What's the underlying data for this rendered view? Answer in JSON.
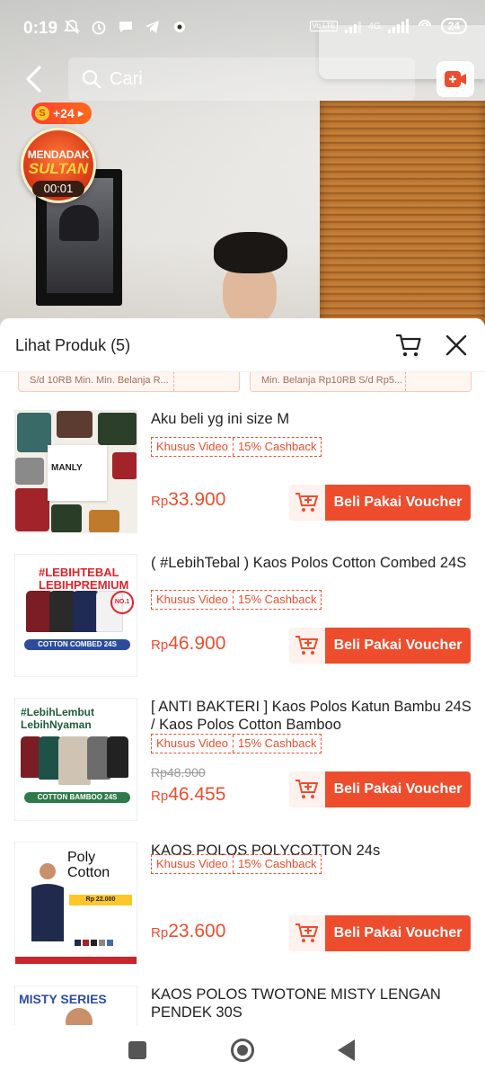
{
  "status_bar": {
    "time": "0:19",
    "battery": "24",
    "network": "4G",
    "volte": "Vo LTE"
  },
  "search": {
    "placeholder": "Cari"
  },
  "live": {
    "coin_badge": "+24",
    "coin_symbol": "S",
    "event_line1": "MENDADAK",
    "event_line2": "SULTAN",
    "event_timer": "00:01"
  },
  "sheet": {
    "title": "Lihat Produk (5)",
    "vouchers": [
      "S/d 10RB Min. Min. Belanja R...",
      "Min. Belanja Rp10RB S/d Rp5..."
    ]
  },
  "products": [
    {
      "title": "Aku beli yg ini size M",
      "tag_primary": "Khusus Video",
      "tag_secondary": "15% Cashback",
      "old_price": "",
      "price_currency": "Rp",
      "price_value": "33.900",
      "button": "Beli Pakai Voucher",
      "thumb_text": "MANLY"
    },
    {
      "title": "( #LebihTebal ) Kaos Polos Cotton Combed 24S",
      "tag_primary": "Khusus Video",
      "tag_secondary": "15% Cashback",
      "old_price": "",
      "price_currency": "Rp",
      "price_value": "46.900",
      "button": "Beli Pakai Voucher",
      "thumb_line1": "#LEBIHTEBAL",
      "thumb_line2": "LEBIHPREMIUM",
      "thumb_band": "COTTON COMBED 24S"
    },
    {
      "title": "[ ANTI BAKTERI ] Kaos Polos Katun Bambu 24S / Kaos Polos Cotton Bamboo",
      "tag_primary": "Khusus Video",
      "tag_secondary": "15% Cashback",
      "old_price": "Rp48.900",
      "price_currency": "Rp",
      "price_value": "46.455",
      "button": "Beli Pakai Voucher",
      "thumb_line1": "#LebihLembut",
      "thumb_line2": "LebihNyaman",
      "thumb_band": "COTTON BAMBOO 24S"
    },
    {
      "title": "KAOS POLOS POLYCOTTON 24s",
      "tag_primary": "Khusus Video",
      "tag_secondary": "15% Cashback",
      "old_price": "",
      "price_currency": "Rp",
      "price_value": "23.600",
      "button": "Beli Pakai Voucher",
      "thumb_line1": "Poly",
      "thumb_line2": "Cotton",
      "thumb_price": "Rp 22.000"
    },
    {
      "title": "KAOS POLOS TWOTONE MISTY LENGAN PENDEK 30S",
      "thumb_text": "MISTY SERIES"
    }
  ],
  "colors": {
    "accent": "#ee4d2d",
    "accent_light": "#fff1ed"
  }
}
